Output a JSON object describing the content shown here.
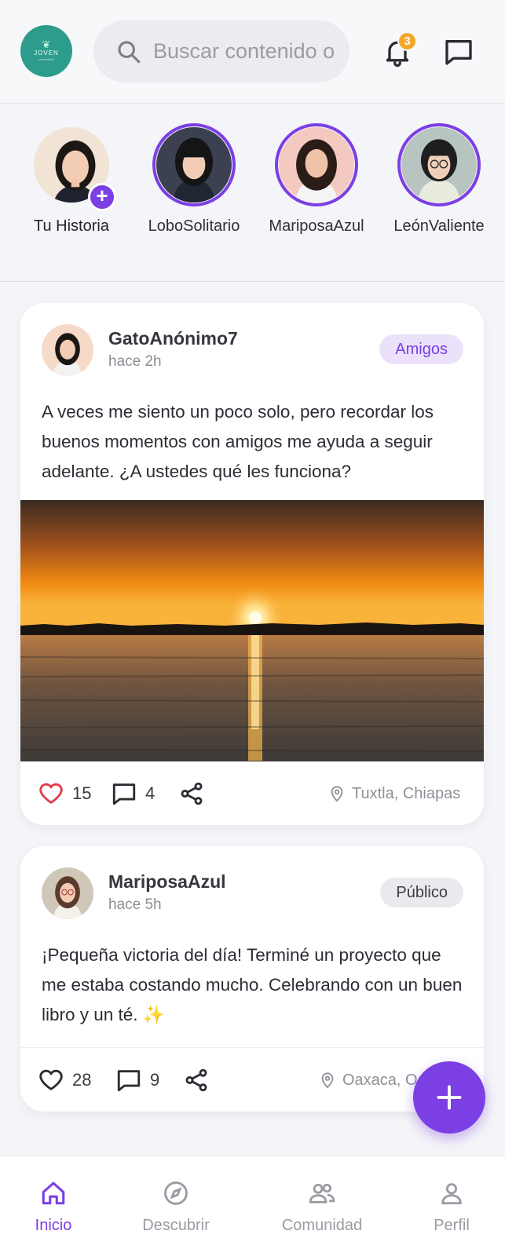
{
  "header": {
    "logo": {
      "brand": "JOVEN",
      "tagline": "comunidad"
    },
    "search_placeholder": "Buscar contenido o personas",
    "notification_count": "3"
  },
  "stories": [
    {
      "name": "Tu Historia",
      "is_self": true
    },
    {
      "name": "LoboSolitario",
      "is_self": false
    },
    {
      "name": "MariposaAzul",
      "is_self": false
    },
    {
      "name": "LeónValiente",
      "is_self": false
    }
  ],
  "posts": [
    {
      "username": "GatoAnónimo7",
      "time": "hace 2h",
      "audience": "Amigos",
      "text": "A veces me siento un poco solo, pero recordar los buenos momentos con amigos me ayuda a seguir adelante. ¿A ustedes qué les funciona?",
      "likes": "15",
      "comments": "4",
      "location": "Tuxtla, Chiapas",
      "liked": true,
      "has_image": true
    },
    {
      "username": "MariposaAzul",
      "time": "hace 5h",
      "audience": "Público",
      "text": "¡Pequeña victoria del día! Terminé un proyecto que me estaba costando mucho. Celebrando con un buen libro y un té. ✨",
      "likes": "28",
      "comments": "9",
      "location": "Oaxaca, Oax.",
      "liked": false,
      "has_image": false
    }
  ],
  "nav": [
    {
      "label": "Inicio",
      "icon": "home-icon",
      "active": true
    },
    {
      "label": "Descubrir",
      "icon": "compass-icon",
      "active": false
    },
    {
      "label": "Comunidad",
      "icon": "people-icon",
      "active": false
    },
    {
      "label": "Perfil",
      "icon": "person-icon",
      "active": false
    }
  ],
  "colors": {
    "accent": "#7c3fe4",
    "badge": "#f4a62a",
    "like": "#e23b4a",
    "logo_bg": "#2e9c8c"
  }
}
